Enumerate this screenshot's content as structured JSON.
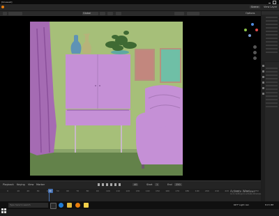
{
  "window": {
    "title": "[Unsaved]"
  },
  "workspace_tabs": [
    "Layout",
    "Modeling",
    "Sculpting",
    "UV Editing",
    "Texture Paint",
    "Shading",
    "Animation",
    "Rendering",
    "Compositing",
    "Scripting"
  ],
  "active_tab": "Layout",
  "scene_selector": "Scene",
  "view_layer": "View Layer",
  "header": {
    "orientation": "Global",
    "options_label": "Options"
  },
  "timeline": {
    "playback": "Playback",
    "keying": "Keying",
    "view": "View",
    "marker": "Marker",
    "current_frame": "40",
    "start_label": "Start",
    "start": "1",
    "end_label": "End",
    "end": "250",
    "ticks": [
      "0",
      "10",
      "20",
      "30",
      "40",
      "50",
      "60",
      "70",
      "80",
      "90",
      "100",
      "110",
      "120",
      "130",
      "140",
      "150",
      "160",
      "170",
      "180",
      "190",
      "200",
      "210",
      "220",
      "230",
      "240",
      "250"
    ]
  },
  "activation": {
    "title": "Activate Windows",
    "subtitle": "Go to Settings to activate Windows."
  },
  "taskbar": {
    "search_placeholder": "Type here to search",
    "weather": "66°F  Light rain",
    "time": "8:15 PM"
  },
  "colors": {
    "wall": "#a6bf79",
    "floor": "#63824a",
    "furniture": "#c590d6",
    "curtain": "#a56bb3",
    "frame_red": "#c2877e",
    "frame_teal": "#6fbfa6",
    "accent": "#4772b3"
  },
  "icons": [
    "blender-logo-icon",
    "windows-start-icon",
    "task-view-icon",
    "edge-icon",
    "file-explorer-icon",
    "blender-taskbar-icon",
    "sticky-notes-icon",
    "play-icon",
    "rewind-icon",
    "skip-end-icon",
    "keyframe-icon"
  ]
}
